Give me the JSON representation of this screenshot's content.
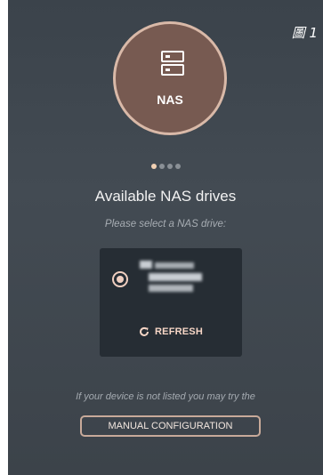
{
  "figure_label": "圖 1",
  "logo": {
    "icon": "nas-drive-icon",
    "label": "NAS"
  },
  "pager": {
    "count": 4,
    "active_index": 0
  },
  "title": "Available NAS drives",
  "subtitle": "Please select a NAS drive:",
  "drive_list": [
    {
      "selected": true
    }
  ],
  "refresh_label": "REFRESH",
  "hint": "If your device is not listed you may try the",
  "manual_config_label": "MANUAL CONFIGURATION",
  "colors": {
    "background": "#3f464e",
    "accent": "#f0cfc0",
    "logo_fill": "#775a51",
    "card": "#262d34"
  }
}
